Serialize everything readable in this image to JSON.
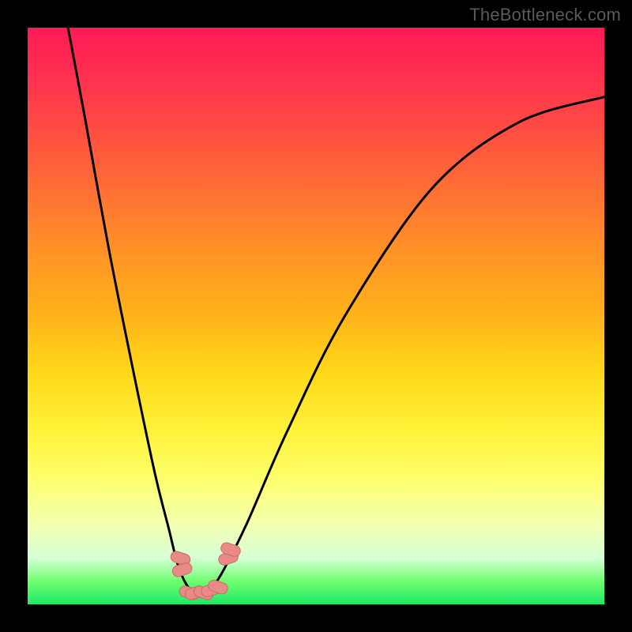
{
  "watermark": "TheBottleneck.com",
  "colors": {
    "frame": "#000000",
    "curve": "#000000",
    "marker_fill": "#e88a86",
    "marker_stroke": "#c96a66"
  },
  "chart_data": {
    "type": "line",
    "title": "",
    "xlabel": "",
    "ylabel": "",
    "xlim": [
      0,
      100
    ],
    "ylim": [
      0,
      100
    ],
    "series": [
      {
        "name": "bottleneck-curve",
        "x": [
          7,
          10,
          14,
          18,
          22,
          24.5,
          26,
          27.5,
          29,
          30.5,
          32,
          34,
          38,
          45,
          55,
          70,
          85,
          100
        ],
        "y": [
          100,
          84,
          62,
          42,
          23,
          13,
          7,
          3.5,
          2,
          2,
          3,
          6,
          14,
          30,
          50,
          72,
          83.5,
          88
        ]
      }
    ],
    "markers": {
      "name": "highlight-points",
      "points": [
        {
          "x": 26.5,
          "y": 8
        },
        {
          "x": 26.8,
          "y": 6
        },
        {
          "x": 28,
          "y": 2
        },
        {
          "x": 29,
          "y": 2
        },
        {
          "x": 30.5,
          "y": 2
        },
        {
          "x": 31.8,
          "y": 2.5
        },
        {
          "x": 33,
          "y": 3
        },
        {
          "x": 34.8,
          "y": 8
        },
        {
          "x": 35.2,
          "y": 9.5
        }
      ]
    }
  }
}
